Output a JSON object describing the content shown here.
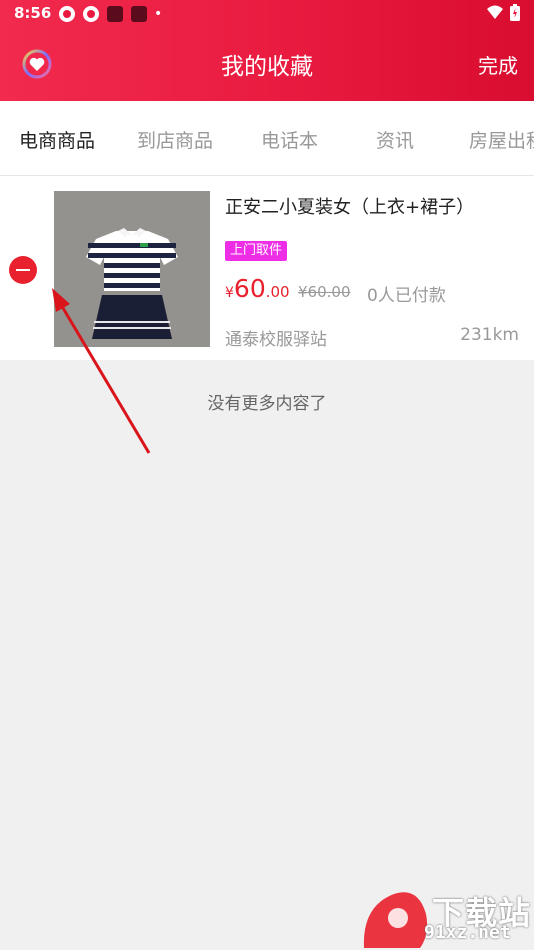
{
  "status_bar": {
    "time": "8:56",
    "dot": "•"
  },
  "header": {
    "title": "我的收藏",
    "done_label": "完成",
    "app_icon": "heart-icon"
  },
  "tabs": [
    {
      "label": "电商商品",
      "active": true
    },
    {
      "label": "到店商品",
      "active": false
    },
    {
      "label": "电话本",
      "active": false
    },
    {
      "label": "资讯",
      "active": false
    },
    {
      "label": "房屋出租",
      "active": false
    }
  ],
  "items": [
    {
      "title": "正安二小夏装女（上衣+裙子）",
      "badge": "上门取件",
      "price_symbol": "¥",
      "price_int": "60",
      "price_dec": ".00",
      "old_price": "¥60.00",
      "paid_count": "0人已付款",
      "store": "通泰校服驿站",
      "distance": "231km"
    }
  ],
  "footer": {
    "no_more": "没有更多内容了"
  },
  "watermark": {
    "text": "下载站",
    "url": "91xz.net"
  },
  "colors": {
    "accent": "#e91a3f",
    "price": "#e9202e",
    "badge": "#ee2de6"
  }
}
